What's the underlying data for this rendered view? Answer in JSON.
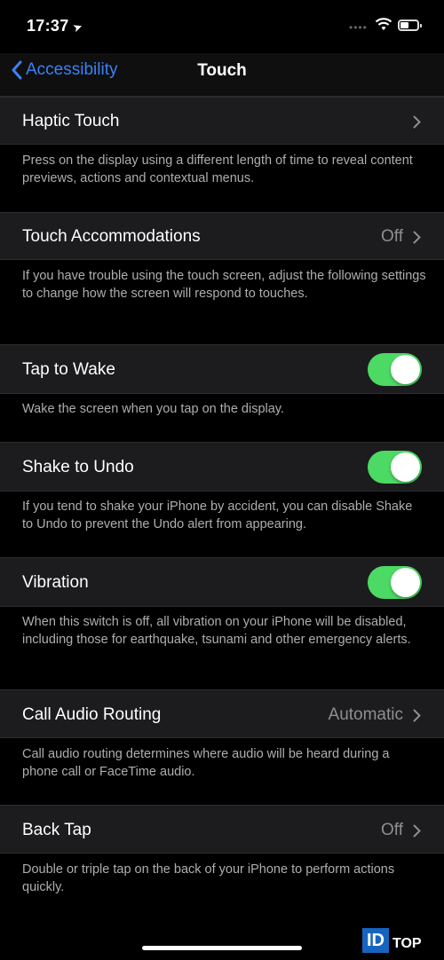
{
  "status_bar": {
    "time": "17:37"
  },
  "nav": {
    "back_label": "Accessibility",
    "title": "Touch"
  },
  "rows": [
    {
      "label": "Haptic Touch",
      "value": "",
      "description": "Press on the display using a different length of time to reveal content previews, actions and contextual menus."
    },
    {
      "label": "Touch Accommodations",
      "value": "Off",
      "description": "If you have trouble using the touch screen, adjust the following settings to change how the screen will respond to touches."
    },
    {
      "label": "Tap to Wake",
      "toggle": true,
      "description": "Wake the screen when you tap on the display."
    },
    {
      "label": "Shake to Undo",
      "toggle": true,
      "description": "If you tend to shake your iPhone by accident, you can disable Shake to Undo to prevent the Undo alert from appearing."
    },
    {
      "label": "Vibration",
      "toggle": true,
      "description": "When this switch is off, all vibration on your iPhone will be disabled, including those for earthquake, tsunami and other emergency alerts."
    },
    {
      "label": "Call Audio Routing",
      "value": "Automatic",
      "description": "Call audio routing determines where audio will be heard during a phone call or FaceTime audio."
    },
    {
      "label": "Back Tap",
      "value": "Off",
      "description": "Double or triple tap on the back of your iPhone to perform actions quickly."
    }
  ],
  "colors": {
    "accent": "#3b82f6",
    "toggle_on": "#4cd964",
    "background": "#000000",
    "cell": "#1c1c1e"
  },
  "watermark": {
    "id": "ID",
    "top": "TOP"
  }
}
